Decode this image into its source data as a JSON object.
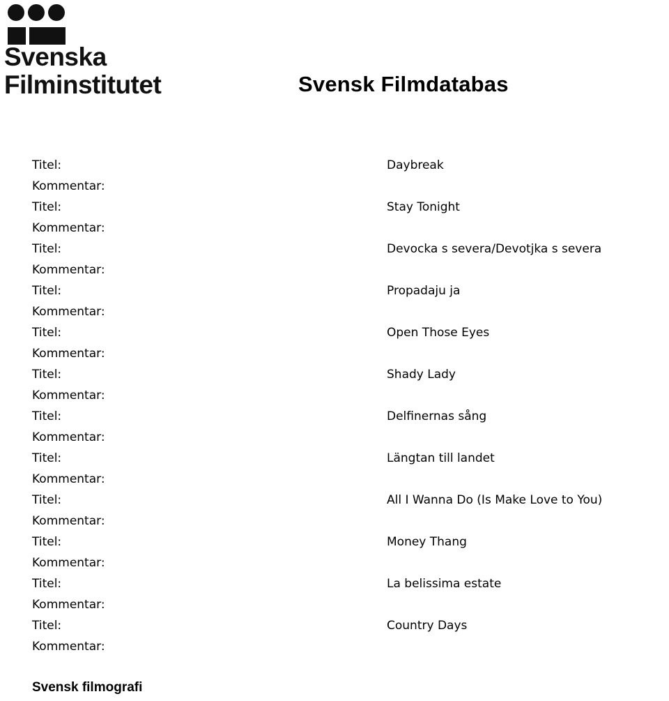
{
  "header": {
    "logo": {
      "name": "svenska-filminstitutet-logo",
      "line1": "Svenska",
      "line2": "Filminstitutet"
    },
    "title": "Svensk Filmdatabas"
  },
  "records": [
    {
      "title_label": "Titel:",
      "title_value": "Daybreak",
      "comment_label": "Kommentar:",
      "comment_value": ""
    },
    {
      "title_label": "Titel:",
      "title_value": "Stay Tonight",
      "comment_label": "Kommentar:",
      "comment_value": ""
    },
    {
      "title_label": "Titel:",
      "title_value": "Devocka s severa/Devotjka s severa",
      "comment_label": "Kommentar:",
      "comment_value": ""
    },
    {
      "title_label": "Titel:",
      "title_value": "Propadaju ja",
      "comment_label": "Kommentar:",
      "comment_value": ""
    },
    {
      "title_label": "Titel:",
      "title_value": "Open Those Eyes",
      "comment_label": "Kommentar:",
      "comment_value": ""
    },
    {
      "title_label": "Titel:",
      "title_value": "Shady Lady",
      "comment_label": "Kommentar:",
      "comment_value": ""
    },
    {
      "title_label": "Titel:",
      "title_value": "Delfinernas sång",
      "comment_label": "Kommentar:",
      "comment_value": ""
    },
    {
      "title_label": "Titel:",
      "title_value": "Längtan till landet",
      "comment_label": "Kommentar:",
      "comment_value": ""
    },
    {
      "title_label": "Titel:",
      "title_value": "All I Wanna Do (Is Make Love to You)",
      "comment_label": "Kommentar:",
      "comment_value": ""
    },
    {
      "title_label": "Titel:",
      "title_value": "Money Thang",
      "comment_label": "Kommentar:",
      "comment_value": ""
    },
    {
      "title_label": "Titel:",
      "title_value": "La belissima estate",
      "comment_label": "Kommentar:",
      "comment_value": ""
    },
    {
      "title_label": "Titel:",
      "title_value": "Country Days",
      "comment_label": "Kommentar:",
      "comment_value": ""
    }
  ],
  "footer": {
    "text": "Svensk filmografi"
  },
  "colors": {
    "text": "#000000",
    "logo": "#111111",
    "background": "#ffffff"
  }
}
